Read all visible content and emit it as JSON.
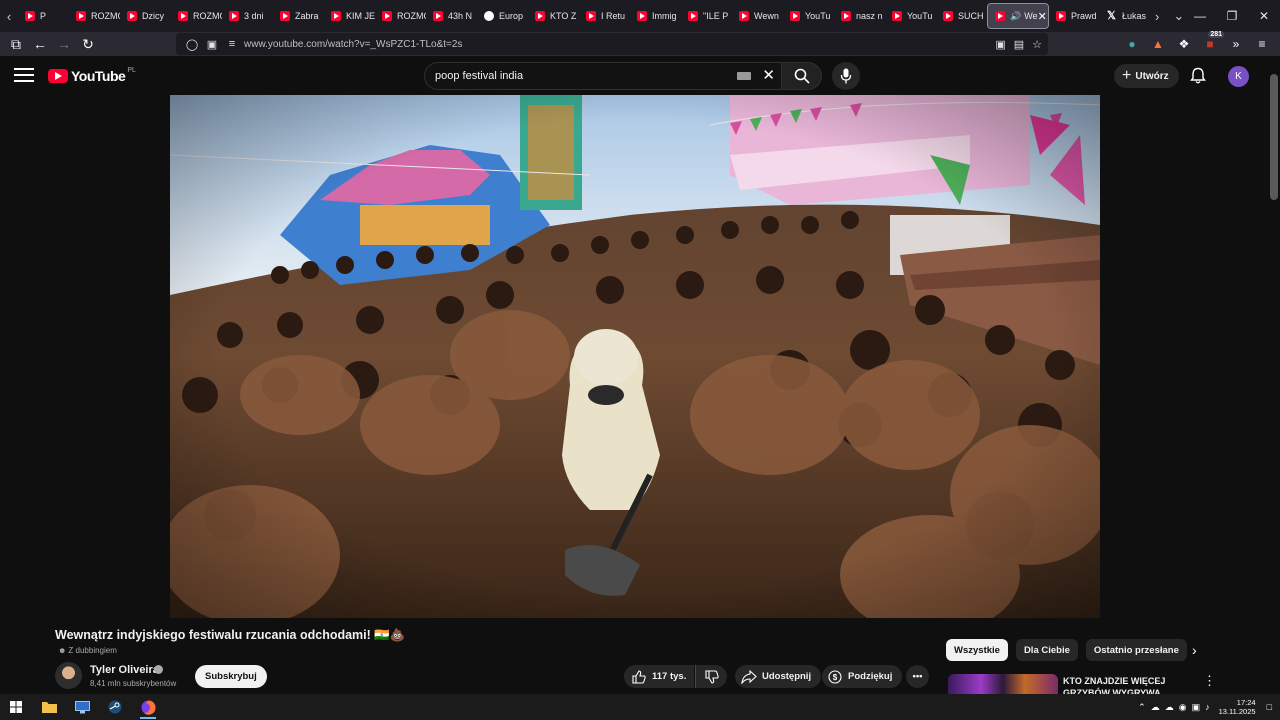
{
  "browser": {
    "tabs": [
      {
        "label": "P",
        "icon": "youtube-icon"
      },
      {
        "label": "ROZMO",
        "icon": "youtube-icon"
      },
      {
        "label": "Dzicy",
        "icon": "youtube-icon"
      },
      {
        "label": "ROZMO",
        "icon": "youtube-icon"
      },
      {
        "label": "3 dni",
        "icon": "youtube-icon"
      },
      {
        "label": "Zabra",
        "icon": "youtube-icon"
      },
      {
        "label": "KIM JE",
        "icon": "youtube-icon"
      },
      {
        "label": "ROZMO",
        "icon": "youtube-icon"
      },
      {
        "label": "43h N",
        "icon": "youtube-icon"
      },
      {
        "label": "Europ",
        "icon": "globe-icon"
      },
      {
        "label": "KTO Z",
        "icon": "youtube-icon"
      },
      {
        "label": "I Retu",
        "icon": "youtube-icon"
      },
      {
        "label": "Immig",
        "icon": "youtube-icon"
      },
      {
        "label": "\"ILE P",
        "icon": "youtube-icon"
      },
      {
        "label": "Wewn",
        "icon": "youtube-icon"
      },
      {
        "label": "YouTu",
        "icon": "youtube-icon"
      },
      {
        "label": "nasz n",
        "icon": "youtube-icon"
      },
      {
        "label": "YouTu",
        "icon": "youtube-icon"
      },
      {
        "label": "SUCH",
        "icon": "youtube-icon"
      }
    ],
    "active_tab": {
      "label": "We",
      "icon": "youtube-icon"
    },
    "tabs_after": [
      {
        "label": "Prawd",
        "icon": "youtube-icon"
      },
      {
        "label": "Łukas",
        "icon": "x-icon"
      }
    ],
    "url": "www.youtube.com/watch?v=_WsPZC1-TLo&t=2s",
    "extension_badge": "281"
  },
  "youtube": {
    "logo_text": "YouTube",
    "country_code": "PL",
    "search_value": "poop festival india",
    "create_label": "Utwórz",
    "avatar_letter": "K"
  },
  "video": {
    "title": "Wewnątrz indyjskiego festiwalu rzucania odchodami! 🇮🇳💩",
    "dubbing": "Z dubbingiem",
    "channel_name": "Tyler Oliveira",
    "subscribers": "8,41 mln subskrybentów",
    "subscribe_label": "Subskrybuj",
    "likes": "117 tys.",
    "share_label": "Udostępnij",
    "thanks_label": "Podziękuj"
  },
  "chips": [
    "Wszystkie",
    "Dla Ciebie",
    "Ostatnio przesłane"
  ],
  "recommendation": {
    "title": "KTO ZNAJDZIE WIĘCEJ GRZYBÓW WYGRYWA *AFERA*"
  },
  "taskbar": {
    "time": "17:24",
    "date": "13.11.2025"
  },
  "colors": {
    "youtube_red": "#ff0033",
    "background": "#0f0f0f",
    "browser_chrome": "#1c1b22",
    "avatar_purple": "#7b4fc6"
  }
}
